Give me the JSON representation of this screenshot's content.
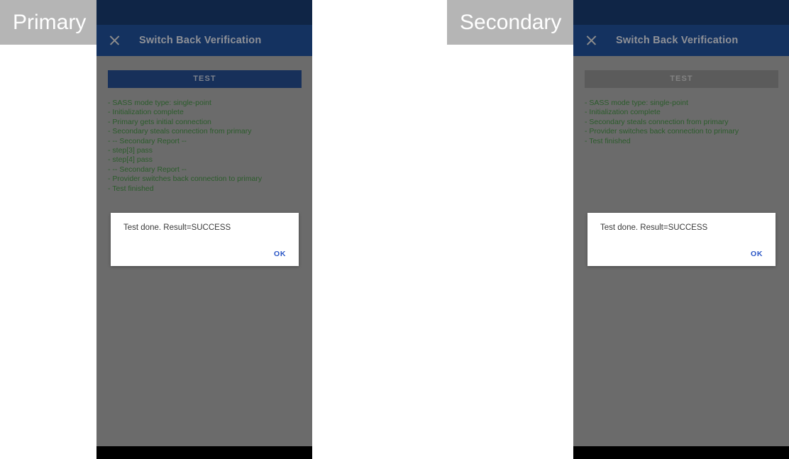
{
  "captions": {
    "primary": "Primary",
    "secondary": "Secondary"
  },
  "colors": {
    "status_bar": "#0f2546",
    "toolbar": "#143260",
    "screen_background": "#6b6b6b",
    "button_enabled": "#17305a",
    "button_disabled": "#5b5b5b",
    "log_text": "#2b5c2b",
    "dialog_background": "#ffffff",
    "dialog_action": "#2a56c6",
    "caption_background": "#b5b5b5",
    "nav_bar": "#000000"
  },
  "primary": {
    "toolbar": {
      "close_icon": "close-icon",
      "title": "Switch Back Verification"
    },
    "test_button": {
      "label": "TEST",
      "enabled": true
    },
    "log_lines": [
      "- SASS mode type: single-point",
      "- Initialization complete",
      "- Primary gets initial connection",
      "- Secondary steals connection from primary",
      "- -- Secondary Report --",
      "- step[3] pass",
      "- step[4] pass",
      "- -- Secondary Report --",
      "- Provider switches back connection to primary",
      "- Test finished"
    ],
    "dialog": {
      "message": "Test done. Result=SUCCESS",
      "ok_label": "OK"
    }
  },
  "secondary": {
    "toolbar": {
      "close_icon": "close-icon",
      "title": "Switch Back Verification"
    },
    "test_button": {
      "label": "TEST",
      "enabled": false
    },
    "log_lines": [
      "- SASS mode type: single-point",
      "- Initialization complete",
      "- Secondary steals connection from primary",
      "- Provider switches back connection to primary",
      "- Test finished"
    ],
    "dialog": {
      "message": "Test done. Result=SUCCESS",
      "ok_label": "OK"
    }
  }
}
